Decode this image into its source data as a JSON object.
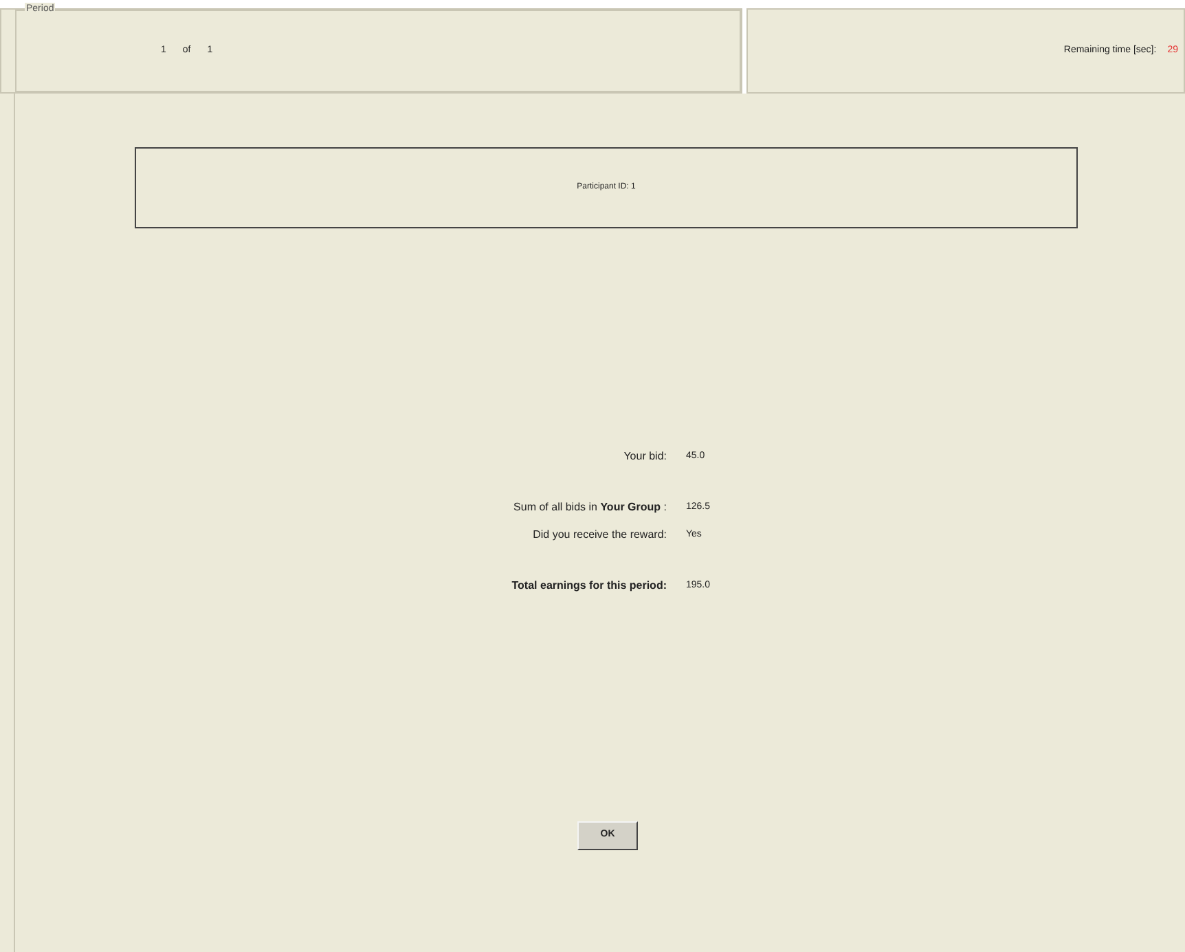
{
  "period": {
    "legend": "Period",
    "current": "1",
    "of": "of",
    "total": "1"
  },
  "timer": {
    "label": "Remaining time [sec]:",
    "value": "29"
  },
  "participant": "Participant ID: 1",
  "result_groups": [
    [
      {
        "label": "Your bid:",
        "value": "45.0",
        "bold": false
      }
    ],
    [
      {
        "label": "Sum of all bids in **Your Group** :",
        "value": "126.5",
        "bold": false
      },
      {
        "label": "Did you receive the reward:",
        "value": "Yes",
        "bold": false
      }
    ],
    [
      {
        "label": "Total earnings for this period:",
        "value": "195.0",
        "bold": true
      }
    ]
  ],
  "button": "OK"
}
